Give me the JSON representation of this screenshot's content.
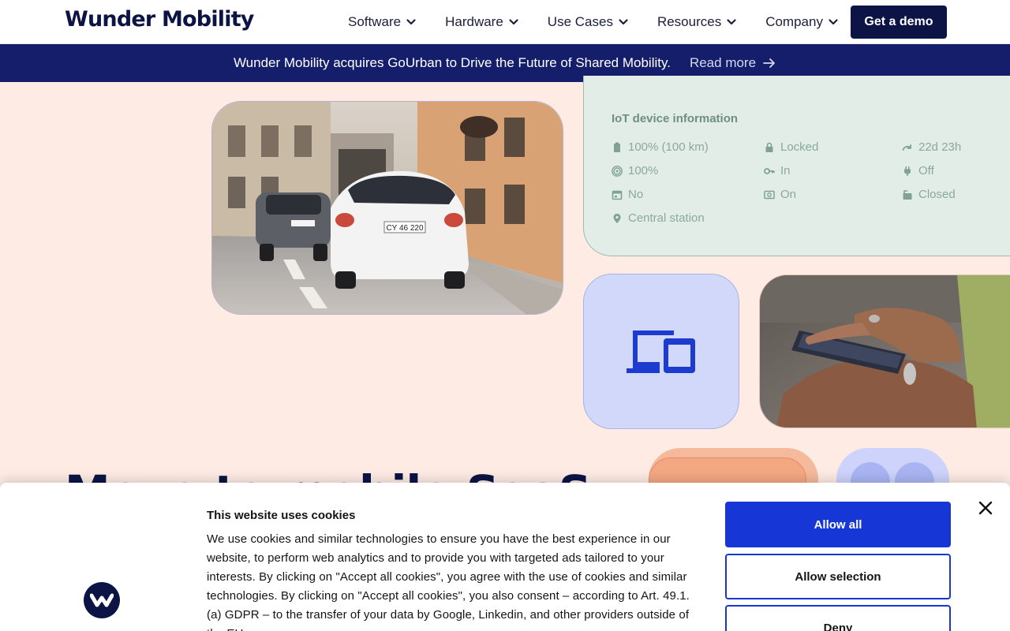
{
  "header": {
    "logo": "Wunder Mobility",
    "nav": [
      {
        "label": "Software"
      },
      {
        "label": "Hardware"
      },
      {
        "label": "Use Cases"
      },
      {
        "label": "Resources"
      },
      {
        "label": "Company"
      }
    ],
    "cta": "Get a demo"
  },
  "banner": {
    "text": "Wunder Mobility acquires GoUrban to Drive the Future of Shared Mobility.",
    "link": "Read more"
  },
  "iot": {
    "title": "IoT device information",
    "battery": "100% (100 km)",
    "signal": "100%",
    "calendar": "No",
    "location": "Central station",
    "lock": "Locked",
    "key": "In",
    "engine": "On",
    "uptime": "22d 23h",
    "plug": "Off",
    "trunk": "Closed"
  },
  "photos": {
    "car_plate": "CY 46 220"
  },
  "hero": {
    "heading": "Move to mobile SaaS"
  },
  "cookie": {
    "title": "This website uses cookies",
    "body": "We use cookies and similar technologies to ensure you have the best experience in our website, to perform web analytics and to provide you with targeted ads tailored to your interests. By clicking on \"Accept all cookies\", you agree with the use of cookies and similar technologies. By clicking on \"Accept all cookies\", you also consent – according to Art. 49.1.(a) GDPR – to the transfer of your data by Google, Linkedin, and other providers outside of the EU.",
    "allow_all": "Allow all",
    "allow_selection": "Allow selection",
    "deny": "Deny"
  },
  "colors": {
    "navy": "#0b1445",
    "banner": "#141e6b",
    "accent_blue": "#1736d6",
    "peach_bg": "#fdebe4",
    "mint_card": "#e3ede8",
    "lavender_tile": "#d2d8fa"
  }
}
